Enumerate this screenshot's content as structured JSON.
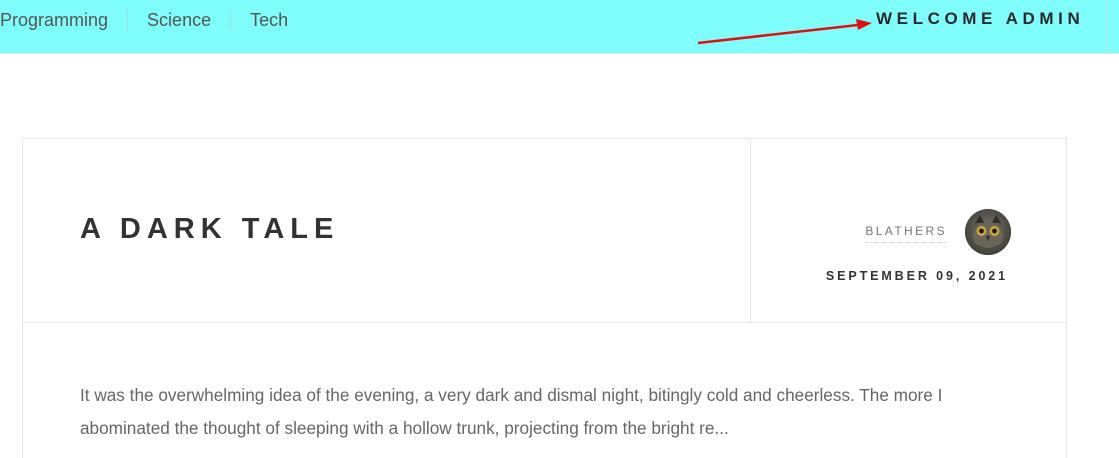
{
  "nav": {
    "items": [
      {
        "label": "Programming"
      },
      {
        "label": "Science"
      },
      {
        "label": "Tech"
      }
    ]
  },
  "header": {
    "welcome": "WELCOME ADMIN"
  },
  "annotation": {
    "arrow_color": "#e01010"
  },
  "post": {
    "title": "A DARK TALE",
    "author": "BLATHERS",
    "date": "SEPTEMBER 09, 2021",
    "excerpt": "It was the overwhelming idea of the evening, a very dark and dismal night, bitingly cold and cheerless. The more I abominated the thought of sleeping with a hollow trunk, projecting from the bright re..."
  },
  "colors": {
    "topbar_bg": "#7ffdfb",
    "title_text": "#333333",
    "body_text": "#666666"
  }
}
